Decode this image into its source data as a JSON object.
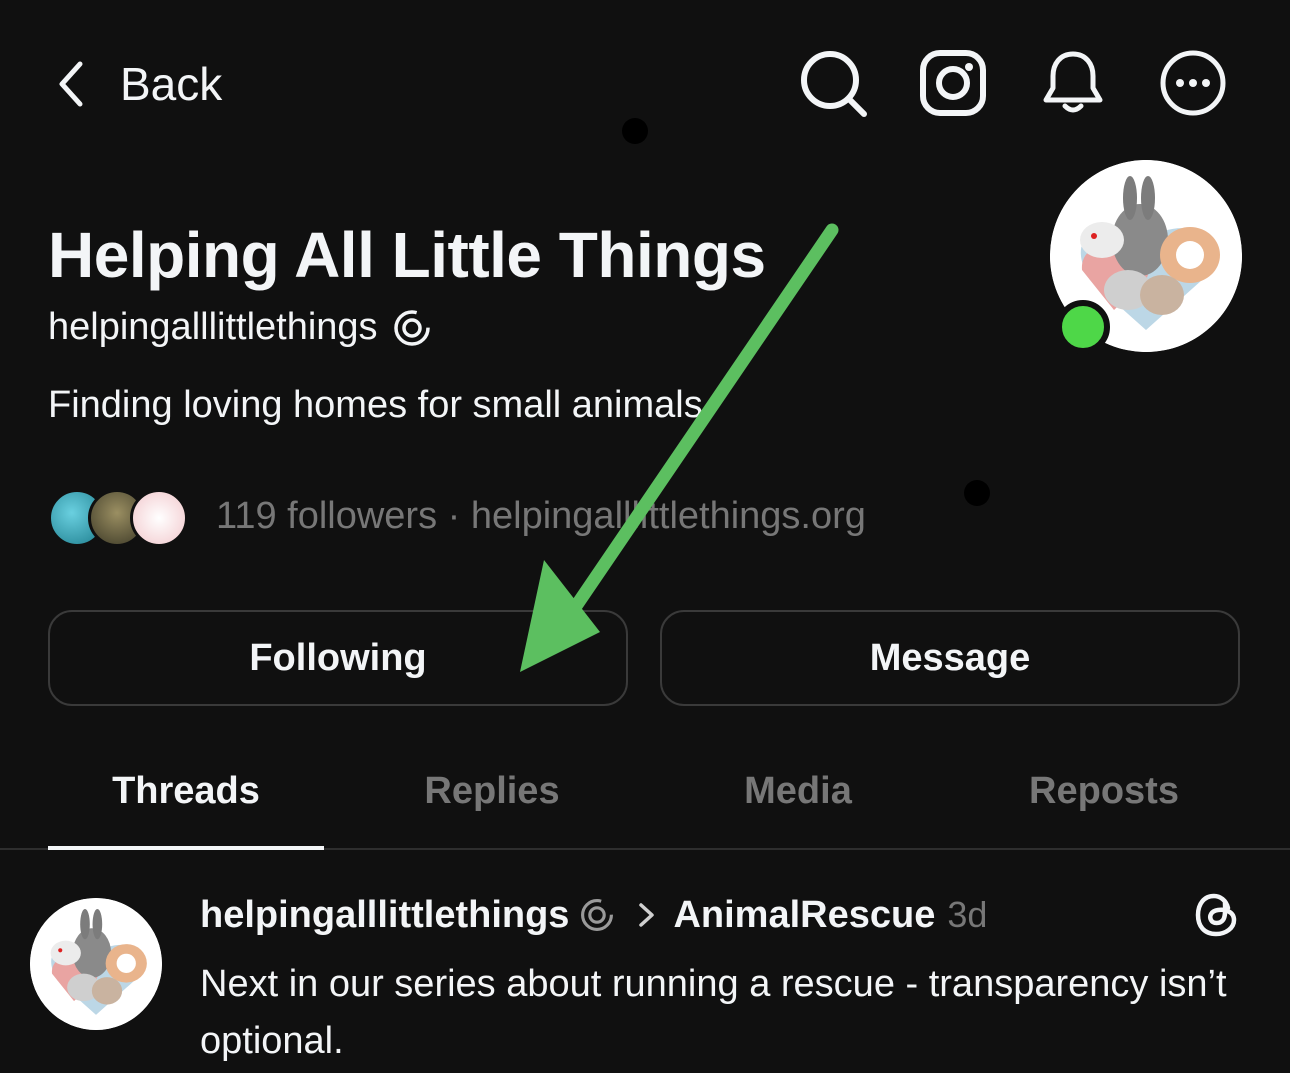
{
  "topbar": {
    "back_label": "Back",
    "icons": [
      "search-icon",
      "instagram-icon",
      "bell-icon",
      "more-icon"
    ]
  },
  "profile": {
    "name": "Helping All Little Things",
    "handle": "helpingalllittlethings",
    "bio": "Finding loving homes for small animals.",
    "followers_text": "119 followers",
    "separator": "·",
    "website": "helpingalllittlethings.org",
    "online_status_color": "#4ed748"
  },
  "buttons": {
    "following_label": "Following",
    "message_label": "Message"
  },
  "tabs": [
    {
      "label": "Threads",
      "active": true
    },
    {
      "label": "Replies",
      "active": false
    },
    {
      "label": "Media",
      "active": false
    },
    {
      "label": "Reposts",
      "active": false
    }
  ],
  "post": {
    "username": "helpingalllittlethings",
    "community": "AnimalRescue",
    "time": "3d",
    "text": "Next in our series about running a rescue -  transparency isn’t optional."
  },
  "annotation": {
    "arrow_color": "#5cbf60"
  },
  "colors": {
    "background": "#101010",
    "text_primary": "#f3f5f7",
    "text_secondary": "#777777",
    "border": "#3a3a3a"
  }
}
